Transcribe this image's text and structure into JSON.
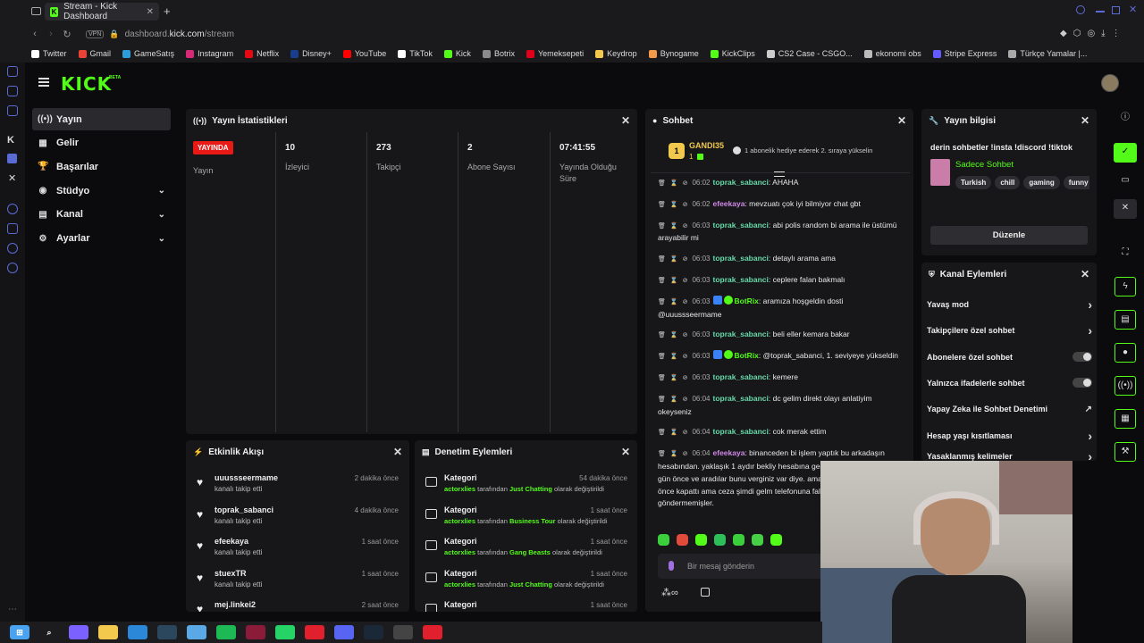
{
  "browser": {
    "tab_title": "Stream - Kick Dashboard",
    "new_tab": "+",
    "vpn": "VPN",
    "url_prefix": "dashboard.",
    "url_domain": "kick.com",
    "url_path": "/stream",
    "bookmarks": [
      {
        "label": "Twitter",
        "color": "#ffffff"
      },
      {
        "label": "Gmail",
        "color": "#ea4335"
      },
      {
        "label": "GameSatış",
        "color": "#2d9cdb"
      },
      {
        "label": "Instagram",
        "color": "#d62976"
      },
      {
        "label": "Netflix",
        "color": "#e50914"
      },
      {
        "label": "Disney+",
        "color": "#1a3e8c"
      },
      {
        "label": "YouTube",
        "color": "#ff0000"
      },
      {
        "label": "TikTok",
        "color": "#ffffff"
      },
      {
        "label": "Kick",
        "color": "#53fc18"
      },
      {
        "label": "Botrix",
        "color": "#8a8a8a"
      },
      {
        "label": "Yemeksepeti",
        "color": "#e0001b"
      },
      {
        "label": "Keydrop",
        "color": "#f2c94c"
      },
      {
        "label": "Bynogame",
        "color": "#f2994a"
      },
      {
        "label": "KickClips",
        "color": "#53fc18"
      },
      {
        "label": "CS2 Case - CSGO...",
        "color": "#cccccc"
      },
      {
        "label": "ekonomi obs",
        "color": "#bbbbbb"
      },
      {
        "label": "Stripe Express",
        "color": "#635bff"
      },
      {
        "label": "Türkçe Yamalar |...",
        "color": "#aaaaaa"
      }
    ]
  },
  "header": {
    "logo": "KICK",
    "beta": "BETA"
  },
  "nav": [
    {
      "label": "Yayın",
      "icon": "((•))",
      "active": true,
      "chevron": false
    },
    {
      "label": "Gelir",
      "icon": "▦",
      "active": false,
      "chevron": false
    },
    {
      "label": "Başarılar",
      "icon": "🏆",
      "active": false,
      "chevron": false
    },
    {
      "label": "Stüdyo",
      "icon": "◉",
      "active": false,
      "chevron": true
    },
    {
      "label": "Kanal",
      "icon": "▤",
      "active": false,
      "chevron": true
    },
    {
      "label": "Ayarlar",
      "icon": "⚙",
      "active": false,
      "chevron": true
    }
  ],
  "stats": {
    "title": "Yayın İstatistikleri",
    "live_badge": "YAYINDA",
    "live_label": "Yayın",
    "items": [
      {
        "value": "10",
        "label": "İzleyici"
      },
      {
        "value": "273",
        "label": "Takipçi"
      },
      {
        "value": "2",
        "label": "Abone Sayısı"
      },
      {
        "value": "07:41:55",
        "label": "Yayında Olduğu Süre"
      }
    ]
  },
  "activity": {
    "title": "Etkinlik Akışı",
    "items": [
      {
        "user": "uuussseermame",
        "desc": "kanalı takip etti",
        "time": "2 dakika önce"
      },
      {
        "user": "toprak_sabanci",
        "desc": "kanalı takip etti",
        "time": "4 dakika önce"
      },
      {
        "user": "efeekaya",
        "desc": "kanalı takip etti",
        "time": "1 saat önce"
      },
      {
        "user": "stuexTR",
        "desc": "kanalı takip etti",
        "time": "1 saat önce"
      },
      {
        "user": "mej.linkei2",
        "desc": "",
        "time": "2 saat önce"
      }
    ]
  },
  "moderation": {
    "title": "Denetim Eylemleri",
    "items": [
      {
        "title": "Kategori",
        "time": "54 dakika önce",
        "actor": "actorxlies",
        "mid": "tarafından",
        "target": "Just Chatting",
        "end": "olarak değiştirildi"
      },
      {
        "title": "Kategori",
        "time": "1 saat önce",
        "actor": "actorxlies",
        "mid": "tarafından",
        "target": "Business Tour",
        "end": "olarak değiştirildi"
      },
      {
        "title": "Kategori",
        "time": "1 saat önce",
        "actor": "actorxlies",
        "mid": "tarafından",
        "target": "Gang Beasts",
        "end": "olarak değiştirildi"
      },
      {
        "title": "Kategori",
        "time": "1 saat önce",
        "actor": "actorxlies",
        "mid": "tarafından",
        "target": "Just Chatting",
        "end": "olarak değiştirildi"
      },
      {
        "title": "Kategori",
        "time": "1 saat önce",
        "actor": "",
        "mid": "",
        "target": "",
        "end": ""
      }
    ]
  },
  "chat": {
    "title": "Sohbet",
    "pinned_user": "GANDI35",
    "pinned_level": "1",
    "pinned_count": "1",
    "pinned_text": "1 abonelik hediye ederek 2. sıraya yükselin",
    "input_placeholder": "Bir mesaj gönderin",
    "messages": [
      {
        "time": "06:02",
        "user": "toprak_sabanci",
        "cls": "u1",
        "bot": false,
        "text": "AHAHA"
      },
      {
        "time": "06:02",
        "user": "efeekaya",
        "cls": "u2",
        "bot": false,
        "text": "mevzuatı çok iyi bilmiyor chat gbt"
      },
      {
        "time": "06:03",
        "user": "toprak_sabanci",
        "cls": "u1",
        "bot": false,
        "text": "abi polis random bi arama ile üstümü arayabilir mi"
      },
      {
        "time": "06:03",
        "user": "toprak_sabanci",
        "cls": "u1",
        "bot": false,
        "text": "detaylı arama ama"
      },
      {
        "time": "06:03",
        "user": "toprak_sabanci",
        "cls": "u1",
        "bot": false,
        "text": "ceplere falan bakmalı"
      },
      {
        "time": "06:03",
        "user": "BotRix",
        "cls": "u3",
        "bot": true,
        "text": "aramıza hoşgeldin dosti @uuussseermame"
      },
      {
        "time": "06:03",
        "user": "toprak_sabanci",
        "cls": "u1",
        "bot": false,
        "text": "beli eller kemara bakar"
      },
      {
        "time": "06:03",
        "user": "BotRix",
        "cls": "u3",
        "bot": true,
        "text": "@toprak_sabanci, 1. seviyeye yükseldin"
      },
      {
        "time": "06:03",
        "user": "toprak_sabanci",
        "cls": "u1",
        "bot": false,
        "text": "kemere"
      },
      {
        "time": "06:04",
        "user": "toprak_sabanci",
        "cls": "u1",
        "bot": false,
        "text": "dc gelim direkt olayı anlatiyim okeyseniz"
      },
      {
        "time": "06:04",
        "user": "toprak_sabanci",
        "cls": "u1",
        "bot": false,
        "text": "cok merak ettim"
      },
      {
        "time": "06:04",
        "user": "efeekaya",
        "cls": "u2",
        "bot": false,
        "text": "binanceden bi işlem yaptık bu arkadaşın hesabından. yaklaşık 1 aydır bekliy hesabına geçmesine. en son 3-4 gün önce ve aradılar bunu verginiz var diye. ama şey de ş şirketi 2 yıl önce kapattı ama ceza şimdi gelm telefonuna falan da tebligat göndermemişler."
      }
    ]
  },
  "stream_info": {
    "title": "Yayın bilgisi",
    "stream_title": "derin sohbetler !insta !discord !tiktok",
    "category": "Sadece Sohbet",
    "tags": [
      "Turkish",
      "chill",
      "gaming",
      "funny"
    ],
    "edit_button": "Düzenle"
  },
  "channel_actions": {
    "title": "Kanal Eylemleri",
    "items": [
      {
        "label": "Yavaş mod",
        "type": "chevron"
      },
      {
        "label": "Takipçilere özel sohbet",
        "type": "chevron"
      },
      {
        "label": "Abonelere özel sohbet",
        "type": "toggle"
      },
      {
        "label": "Yalnızca ifadelerle sohbet",
        "type": "toggle"
      },
      {
        "label": "Yapay Zeka ile Sohbet Denetimi",
        "type": "external"
      },
      {
        "label": "Hesap yaşı kısıtlaması",
        "type": "chevron"
      },
      {
        "label": "Yasaklanmış kelimeler",
        "type": "chevron"
      }
    ]
  },
  "colors": {
    "accent": "#53fc18",
    "live": "#e91916"
  }
}
